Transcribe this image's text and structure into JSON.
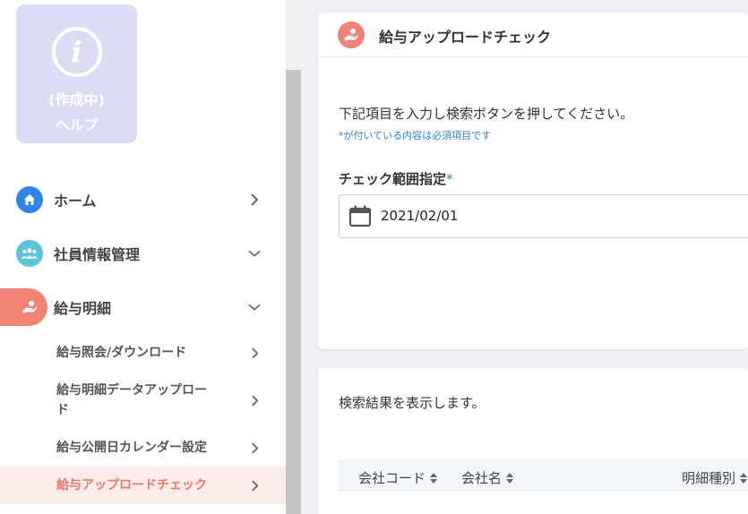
{
  "help": {
    "icon": "info-icon",
    "line1": "(作成中)",
    "line2": "ヘルプ"
  },
  "sidebar": {
    "items": [
      {
        "label": "ホーム",
        "icon": "home-icon",
        "icon_color": "#2f86e8",
        "chevron": "right"
      },
      {
        "label": "社員情報管理",
        "icon": "people-icon",
        "icon_color": "#5bc4d8",
        "chevron": "down"
      },
      {
        "label": "給与明細",
        "icon": "hand-money-icon",
        "icon_color": "#f08276",
        "chevron": "down",
        "active": true
      }
    ],
    "sub_items": [
      {
        "label": "給与照会/ダウンロード"
      },
      {
        "label": "給与明細データアップロー",
        "label_line2": "ド"
      },
      {
        "label": "給与公開日カレンダー設定"
      },
      {
        "label": "給与アップロードチェック",
        "active": true
      }
    ]
  },
  "main": {
    "title": "給与アップロードチェック",
    "title_icon": "hand-money-icon",
    "instruction": "下記項目を入力し検索ボタンを押してください。",
    "required_note": "*が付いている内容は必須項目です",
    "field_label": "チェック範囲指定",
    "field_required_mark": "*",
    "date_value": "2021/02/01",
    "result_text": "検索結果を表示します。",
    "columns": [
      "会社コード",
      "会社名",
      "明細種別"
    ]
  },
  "colors": {
    "accent": "#f08276",
    "link_blue": "#2f7fd6",
    "help_card": "#dcdcf4"
  }
}
